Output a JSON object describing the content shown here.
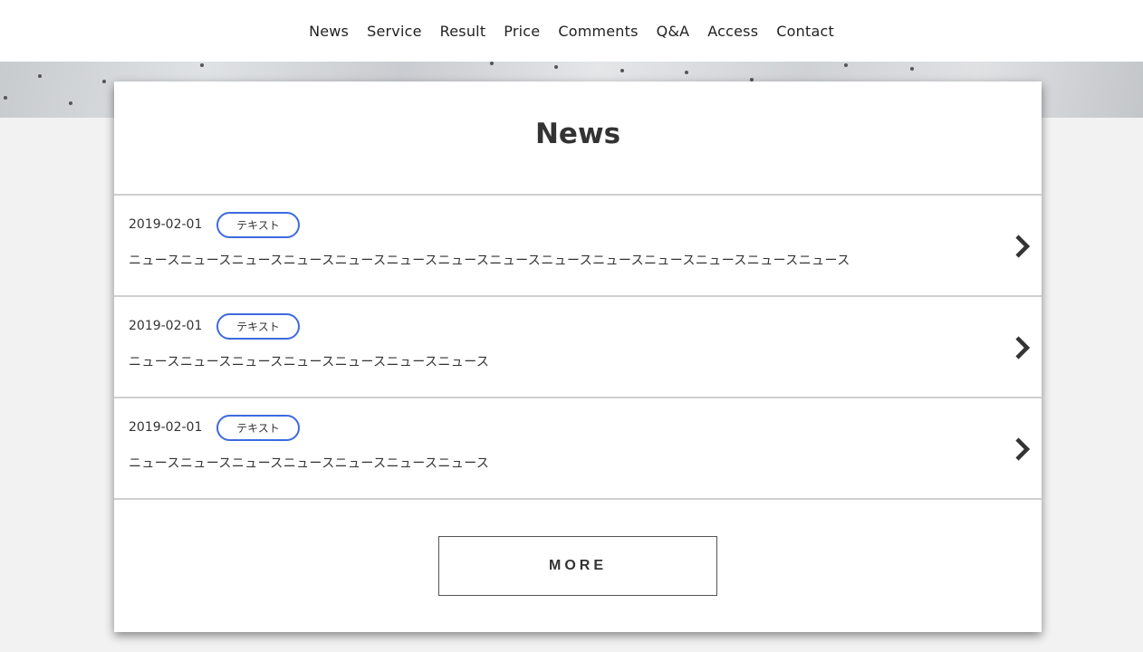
{
  "nav": {
    "items": [
      {
        "label": "News"
      },
      {
        "label": "Service"
      },
      {
        "label": "Result"
      },
      {
        "label": "Price"
      },
      {
        "label": "Comments"
      },
      {
        "label": "Q&A"
      },
      {
        "label": "Access"
      },
      {
        "label": "Contact"
      }
    ]
  },
  "news": {
    "title": "News",
    "items": [
      {
        "date": "2019-02-01",
        "tag": "テキスト",
        "text": "ニュースニュースニュースニュースニュースニュースニュースニュースニュースニュースニュースニュースニュースニュース"
      },
      {
        "date": "2019-02-01",
        "tag": "テキスト",
        "text": "ニュースニュースニュースニュースニュースニュースニュース"
      },
      {
        "date": "2019-02-01",
        "tag": "テキスト",
        "text": "ニュースニュースニュースニュースニュースニュースニュース"
      }
    ],
    "more_label": "MORE",
    "colors": {
      "tag_border": "#3d6ae0",
      "background": "#f2f2f2"
    }
  },
  "icons": {
    "item_arrow": "chevron-right-icon"
  }
}
